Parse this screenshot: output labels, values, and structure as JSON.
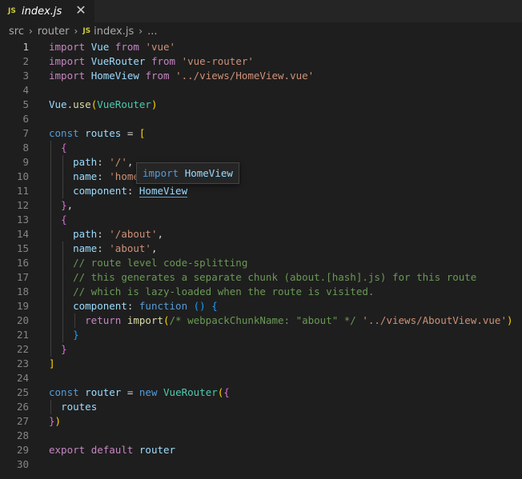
{
  "tab": {
    "badge": "JS",
    "title": "index.js",
    "close_glyph": "✕"
  },
  "breadcrumb": {
    "items": [
      "src",
      "router",
      "index.js",
      "..."
    ],
    "separator": "›",
    "file_badge": "JS"
  },
  "tooltip": {
    "keyword": "import",
    "name": "HomeView"
  },
  "colors": {
    "background": "#1e1e1e",
    "keyword": "#569cd6",
    "control_keyword": "#c586c0",
    "variable": "#9cdcfe",
    "class": "#4ec9b0",
    "function": "#dcdcaa",
    "string": "#ce9178",
    "comment": "#6a9955",
    "js_badge": "#cbcb41"
  },
  "icons": {
    "tab_file": "javascript-file-icon",
    "tab_close": "close-icon",
    "breadcrumb_separator": "chevron-right-icon"
  },
  "code": {
    "active_line": 1,
    "lines": [
      {
        "n": "1",
        "t": [
          [
            "kwc",
            "import"
          ],
          [
            "pun",
            " "
          ],
          [
            "var",
            "Vue"
          ],
          [
            "pun",
            " "
          ],
          [
            "kwc",
            "from"
          ],
          [
            "pun",
            " "
          ],
          [
            "str",
            "'vue'"
          ]
        ]
      },
      {
        "n": "2",
        "t": [
          [
            "kwc",
            "import"
          ],
          [
            "pun",
            " "
          ],
          [
            "var",
            "VueRouter"
          ],
          [
            "pun",
            " "
          ],
          [
            "kwc",
            "from"
          ],
          [
            "pun",
            " "
          ],
          [
            "str",
            "'vue-router'"
          ]
        ]
      },
      {
        "n": "3",
        "t": [
          [
            "kwc",
            "import"
          ],
          [
            "pun",
            " "
          ],
          [
            "var",
            "HomeView"
          ],
          [
            "pun",
            " "
          ],
          [
            "kwc",
            "from"
          ],
          [
            "pun",
            " "
          ],
          [
            "str",
            "'../views/HomeView.vue'"
          ]
        ]
      },
      {
        "n": "4",
        "t": []
      },
      {
        "n": "5",
        "t": [
          [
            "var",
            "Vue"
          ],
          [
            "pun",
            "."
          ],
          [
            "fn",
            "use"
          ],
          [
            "br1",
            "("
          ],
          [
            "cls",
            "VueRouter"
          ],
          [
            "br1",
            ")"
          ]
        ]
      },
      {
        "n": "6",
        "t": []
      },
      {
        "n": "7",
        "t": [
          [
            "kw",
            "const"
          ],
          [
            "pun",
            " "
          ],
          [
            "var",
            "routes"
          ],
          [
            "pun",
            " = "
          ],
          [
            "br1",
            "["
          ]
        ]
      },
      {
        "n": "8",
        "t": [
          [
            "pun",
            "  "
          ],
          [
            "br2",
            "{"
          ]
        ]
      },
      {
        "n": "9",
        "t": [
          [
            "pun",
            "    "
          ],
          [
            "var",
            "path"
          ],
          [
            "pun",
            ": "
          ],
          [
            "str",
            "'/'"
          ],
          [
            "pun",
            ","
          ]
        ]
      },
      {
        "n": "10",
        "t": [
          [
            "pun",
            "    "
          ],
          [
            "var",
            "name"
          ],
          [
            "pun",
            ": "
          ],
          [
            "str",
            "'home"
          ]
        ]
      },
      {
        "n": "11",
        "t": [
          [
            "pun",
            "    "
          ],
          [
            "var",
            "component"
          ],
          [
            "pun",
            ": "
          ],
          [
            "var",
            "HomeView"
          ]
        ]
      },
      {
        "n": "12",
        "t": [
          [
            "pun",
            "  "
          ],
          [
            "br2",
            "}"
          ],
          [
            "pun",
            ","
          ]
        ]
      },
      {
        "n": "13",
        "t": [
          [
            "pun",
            "  "
          ],
          [
            "br2",
            "{"
          ]
        ]
      },
      {
        "n": "14",
        "t": [
          [
            "pun",
            "    "
          ],
          [
            "var",
            "path"
          ],
          [
            "pun",
            ": "
          ],
          [
            "str",
            "'/about'"
          ],
          [
            "pun",
            ","
          ]
        ]
      },
      {
        "n": "15",
        "t": [
          [
            "pun",
            "    "
          ],
          [
            "var",
            "name"
          ],
          [
            "pun",
            ": "
          ],
          [
            "str",
            "'about'"
          ],
          [
            "pun",
            ","
          ]
        ]
      },
      {
        "n": "16",
        "t": [
          [
            "pun",
            "    "
          ],
          [
            "cmt",
            "// route level code-splitting"
          ]
        ]
      },
      {
        "n": "17",
        "t": [
          [
            "pun",
            "    "
          ],
          [
            "cmt",
            "// this generates a separate chunk (about.[hash].js) for this route"
          ]
        ]
      },
      {
        "n": "18",
        "t": [
          [
            "pun",
            "    "
          ],
          [
            "cmt",
            "// which is lazy-loaded when the route is visited."
          ]
        ]
      },
      {
        "n": "19",
        "t": [
          [
            "pun",
            "    "
          ],
          [
            "var",
            "component"
          ],
          [
            "pun",
            ": "
          ],
          [
            "kw",
            "function"
          ],
          [
            "pun",
            " "
          ],
          [
            "br3",
            "()"
          ],
          [
            "pun",
            " "
          ],
          [
            "br3",
            "{"
          ]
        ]
      },
      {
        "n": "20",
        "t": [
          [
            "pun",
            "      "
          ],
          [
            "kwc",
            "return"
          ],
          [
            "pun",
            " "
          ],
          [
            "fn",
            "import"
          ],
          [
            "br1",
            "("
          ],
          [
            "cmt",
            "/* webpackChunkName: \"about\" */"
          ],
          [
            "pun",
            " "
          ],
          [
            "str",
            "'../views/AboutView.vue'"
          ],
          [
            "br1",
            ")"
          ]
        ]
      },
      {
        "n": "21",
        "t": [
          [
            "pun",
            "    "
          ],
          [
            "br3",
            "}"
          ]
        ]
      },
      {
        "n": "22",
        "t": [
          [
            "pun",
            "  "
          ],
          [
            "br2",
            "}"
          ]
        ]
      },
      {
        "n": "23",
        "t": [
          [
            "br1",
            "]"
          ]
        ]
      },
      {
        "n": "24",
        "t": []
      },
      {
        "n": "25",
        "t": [
          [
            "kw",
            "const"
          ],
          [
            "pun",
            " "
          ],
          [
            "var",
            "router"
          ],
          [
            "pun",
            " = "
          ],
          [
            "kw",
            "new"
          ],
          [
            "pun",
            " "
          ],
          [
            "cls",
            "VueRouter"
          ],
          [
            "br1",
            "("
          ],
          [
            "br2",
            "{"
          ]
        ]
      },
      {
        "n": "26",
        "t": [
          [
            "pun",
            "  "
          ],
          [
            "var",
            "routes"
          ]
        ]
      },
      {
        "n": "27",
        "t": [
          [
            "br2",
            "}"
          ],
          [
            "br1",
            ")"
          ]
        ]
      },
      {
        "n": "28",
        "t": []
      },
      {
        "n": "29",
        "t": [
          [
            "kwc",
            "export"
          ],
          [
            "pun",
            " "
          ],
          [
            "kwc",
            "default"
          ],
          [
            "pun",
            " "
          ],
          [
            "var",
            "router"
          ]
        ]
      },
      {
        "n": "30",
        "t": []
      }
    ]
  }
}
